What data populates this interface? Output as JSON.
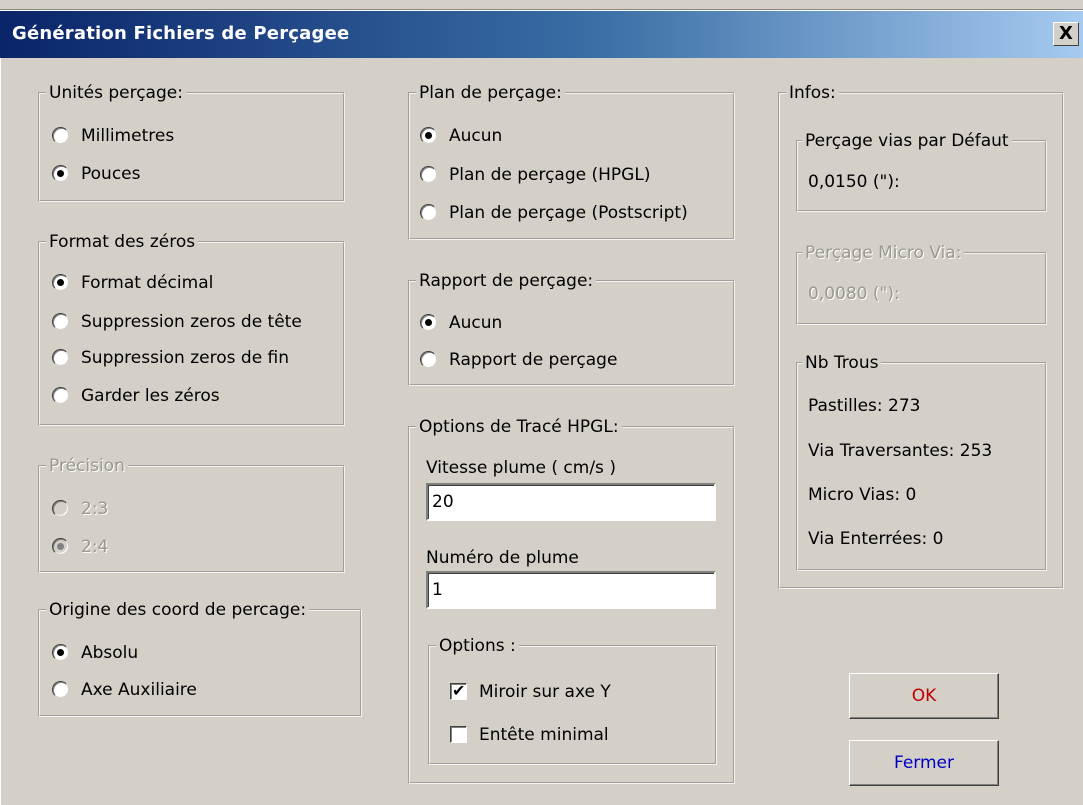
{
  "window": {
    "title": "Génération Fichiers de Perçagee",
    "close_label": "X"
  },
  "units": {
    "legend": "Unités perçage:",
    "options": [
      "Millimetres",
      "Pouces"
    ],
    "selected": 1
  },
  "zero_format": {
    "legend": "Format des zéros",
    "options": [
      "Format décimal",
      "Suppression zeros de tête",
      "Suppression zeros de fin",
      "Garder les zéros"
    ],
    "selected": 0
  },
  "precision": {
    "legend": "Précision",
    "options": [
      "2:3",
      "2:4"
    ],
    "selected": 1,
    "enabled": false
  },
  "origin": {
    "legend": "Origine des coord de percage:",
    "options": [
      "Absolu",
      "Axe Auxiliaire"
    ],
    "selected": 0
  },
  "drill_map": {
    "legend": "Plan de perçage:",
    "options": [
      "Aucun",
      "Plan de perçage (HPGL)",
      "Plan de perçage (Postscript)"
    ],
    "selected": 0
  },
  "drill_report": {
    "legend": "Rapport de perçage:",
    "options": [
      "Aucun",
      "Rapport de perçage"
    ],
    "selected": 0
  },
  "hpgl": {
    "legend": "Options de Tracé HPGL:",
    "speed_label": "Vitesse plume ( cm/s )",
    "speed_value": "20",
    "pen_label": "Numéro de plume",
    "pen_value": "1",
    "options_legend": "Options :",
    "mirror_label": "Miroir sur axe Y",
    "mirror_checked": true,
    "minimal_header_label": "Entête minimal",
    "minimal_header_checked": false
  },
  "infos": {
    "legend": "Infos:",
    "default_via": {
      "legend": "Perçage vias par Défaut",
      "value": "0,0150 (\"):"
    },
    "micro_via": {
      "legend": "Perçage Micro Via:",
      "value": "0,0080 (\"):"
    },
    "holes": {
      "legend": "Nb Trous",
      "pads": "Pastilles: 273",
      "through_vias": "Via Traversantes: 253",
      "micro_vias": "Micro Vias: 0",
      "buried_vias": "Via Enterrées: 0"
    }
  },
  "buttons": {
    "ok": "OK",
    "close": "Fermer",
    "ok_color": "#c00000",
    "close_color": "#0000c0"
  }
}
